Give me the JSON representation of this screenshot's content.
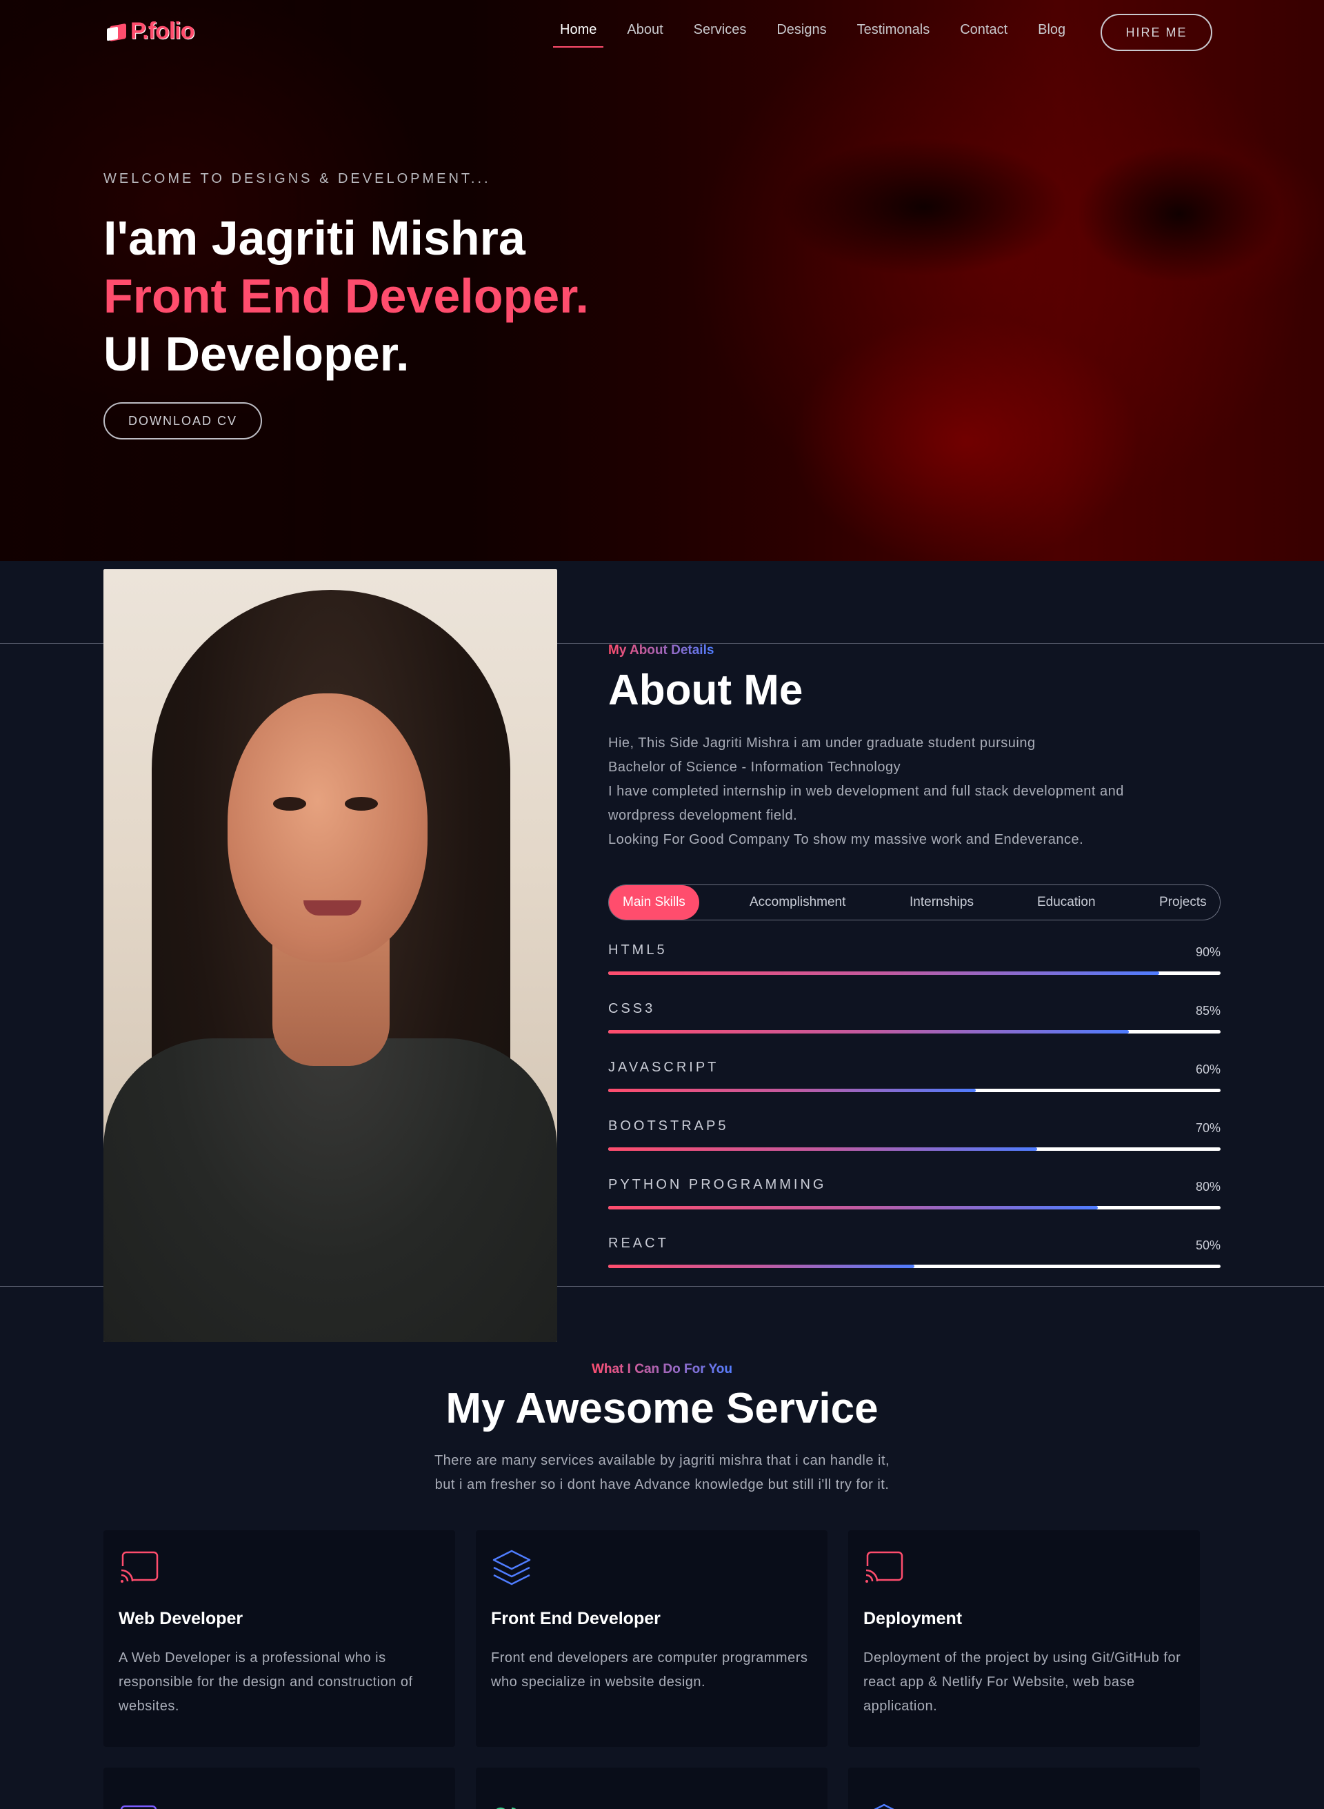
{
  "brand": {
    "logo_text": "P.folio",
    "accent": "#ff4d6d",
    "accent2": "#4f7dff",
    "background": "#0e1321"
  },
  "nav": {
    "items": [
      {
        "label": "Home",
        "active": true
      },
      {
        "label": "About"
      },
      {
        "label": "Services"
      },
      {
        "label": "Designs"
      },
      {
        "label": "Testimonals"
      },
      {
        "label": "Contact"
      },
      {
        "label": "Blog"
      }
    ],
    "hire_label": "HIRE ME"
  },
  "hero": {
    "welcome": "WELCOME TO DESIGNS & DEVELOPMENT...",
    "line1": "I'am Jagriti Mishra",
    "line2": "Front End Developer.",
    "line3": "UI Developer.",
    "cta": "DOWNLOAD CV"
  },
  "about": {
    "subtitle": "My About Details",
    "title": "About Me",
    "paragraph": [
      "Hie, This Side Jagriti Mishra i am under graduate student pursuing",
      "Bachelor of Science - Information Technology",
      "I have completed internship in web development and full stack development and",
      "wordpress development field.",
      "Looking For Good Company To show my massive work and Endeverance."
    ],
    "tabs": [
      {
        "label": "Main Skills",
        "active": true
      },
      {
        "label": "Accomplishment"
      },
      {
        "label": "Internships"
      },
      {
        "label": "Education"
      },
      {
        "label": "Projects"
      }
    ],
    "skills": [
      {
        "name": "HTML5",
        "value": 90,
        "label": "90%"
      },
      {
        "name": "CSS3",
        "value": 85,
        "label": "85%"
      },
      {
        "name": "JAVASCRIPT",
        "value": 60,
        "label": "60%"
      },
      {
        "name": "BOOTSTRAP5",
        "value": 70,
        "label": "70%"
      },
      {
        "name": "PYTHON PROGRAMMING",
        "value": 80,
        "label": "80%"
      },
      {
        "name": "REACT",
        "value": 50,
        "label": "50%"
      }
    ]
  },
  "services": {
    "subtitle": "What I Can Do For You",
    "title": "My Awesome Service",
    "description": [
      "There are many services available by jagriti mishra that i can handle it,",
      "but i am fresher so i dont have Advance knowledge but still i'll try for it."
    ],
    "cards": [
      {
        "icon": "cast-icon",
        "icon_color": "#ff4d6d",
        "title": "Web Developer",
        "text": "A Web Developer is a professional who is responsible for the design and construction of websites."
      },
      {
        "icon": "layers-icon",
        "icon_color": "#4f7dff",
        "title": "Front End Developer",
        "text": "Front end developers are computer programmers who specialize in website design."
      },
      {
        "icon": "cast-icon",
        "icon_color": "#ff4d6d",
        "title": "Deployment",
        "text": "Deployment of the project by using Git/GitHub for react app & Netlify For Website, web base application."
      }
    ],
    "cards_row2": [
      {
        "icon": "square-icon",
        "icon_color": "#7b5cff"
      },
      {
        "icon": "toggle-icon",
        "icon_color": "#3ecf8e"
      },
      {
        "icon": "layers-icon",
        "icon_color": "#4f7dff"
      }
    ]
  }
}
